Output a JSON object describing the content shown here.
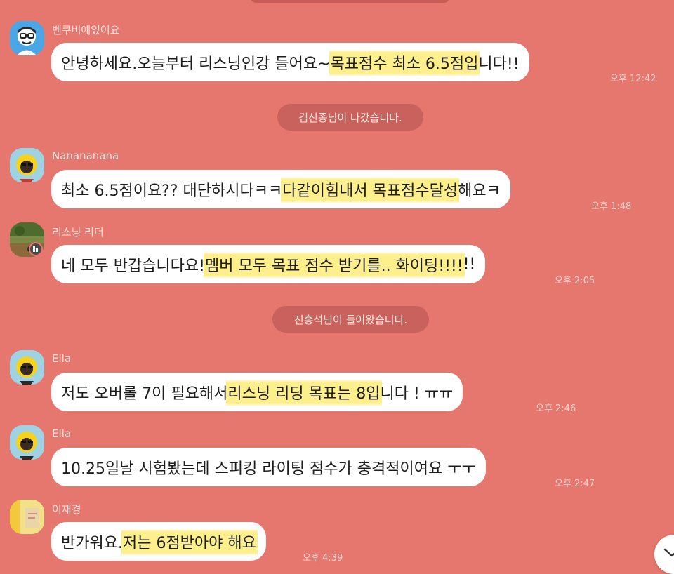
{
  "messages": [
    {
      "sender": "벤쿠버에있어요",
      "parts": [
        "안녕하세요.오늘부터 리스닝인강 들어요~ ",
        "목표점수 최소 6.5점입",
        "니다!!"
      ],
      "time": "오후 12:42"
    },
    {
      "sender": "Nanananana",
      "parts": [
        "최소 6.5점이요?? 대단하시다ㅋㅋ ",
        "다같이힘내서 목표점수달성",
        "해요ㅋ"
      ],
      "time": "오후 1:48"
    },
    {
      "sender": "리스닝 리더",
      "parts": [
        "네 모두 반갑습니다요! ",
        "멤버 모두 목표 점수 받기를.. 화이팅!!!!",
        "!!"
      ],
      "time": "오후 2:05"
    },
    {
      "sender": "Ella",
      "parts": [
        "저도 오버롤 7이 필요해서 ",
        "리스닝 리딩 목표는 8입",
        "니다 ! ㅠㅠ"
      ],
      "time": "오후 2:46"
    },
    {
      "sender": "Ella",
      "parts": [
        "10.25일날 시험봤는데 스피킹 라이팅 점수가 충격적이여요 ㅜㅜ",
        "",
        ""
      ],
      "time": "오후 2:47"
    },
    {
      "sender": "이재경",
      "parts": [
        "반가워요.",
        "저는 6점받아야 해요",
        ""
      ],
      "time": "오후 4:39"
    }
  ],
  "notices": [
    "김신종님이 나갔습니다.",
    "진흥석님이 들어왔습니다."
  ],
  "colors": {
    "background": "#e5776e",
    "bubble": "#ffffff",
    "highlight": "#fdec78",
    "notice": "#c9625c"
  },
  "icons": {
    "scroll_down": "chevron-down-icon",
    "leader_badge": "crown-badge-icon"
  }
}
